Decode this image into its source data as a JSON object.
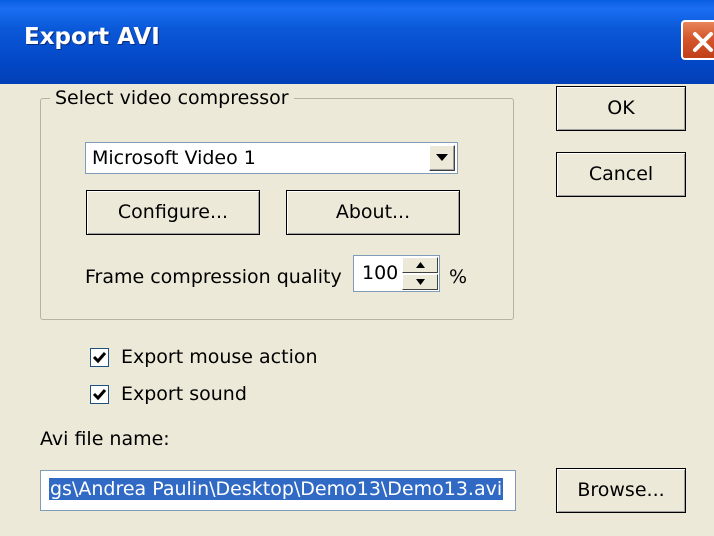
{
  "dialog": {
    "title": "Export AVI"
  },
  "compressor_group": {
    "legend": "Select video compressor",
    "compressor_value": "Microsoft Video 1",
    "configure_label": "Configure...",
    "about_label": "About...",
    "quality_label": "Frame compression quality",
    "quality_value": "100",
    "quality_unit": "%"
  },
  "options": {
    "export_mouse_action": {
      "label": "Export mouse action",
      "checked": true
    },
    "export_sound": {
      "label": "Export sound",
      "checked": true
    }
  },
  "file": {
    "label": "Avi file name:",
    "value": "gs\\Andrea Paulin\\Desktop\\Demo13\\Demo13.avi",
    "browse_label": "Browse..."
  },
  "actions": {
    "ok_label": "OK",
    "cancel_label": "Cancel"
  },
  "icons": {
    "close": "close-icon",
    "dropdown": "chevron-down-icon",
    "spin_up": "arrow-up-icon",
    "spin_down": "arrow-down-icon",
    "check": "checkmark-icon"
  },
  "colors": {
    "titlebar": "#0347c6",
    "dialog_bg": "#ece9d8",
    "selection": "#316ac5",
    "close": "#d5562c"
  }
}
